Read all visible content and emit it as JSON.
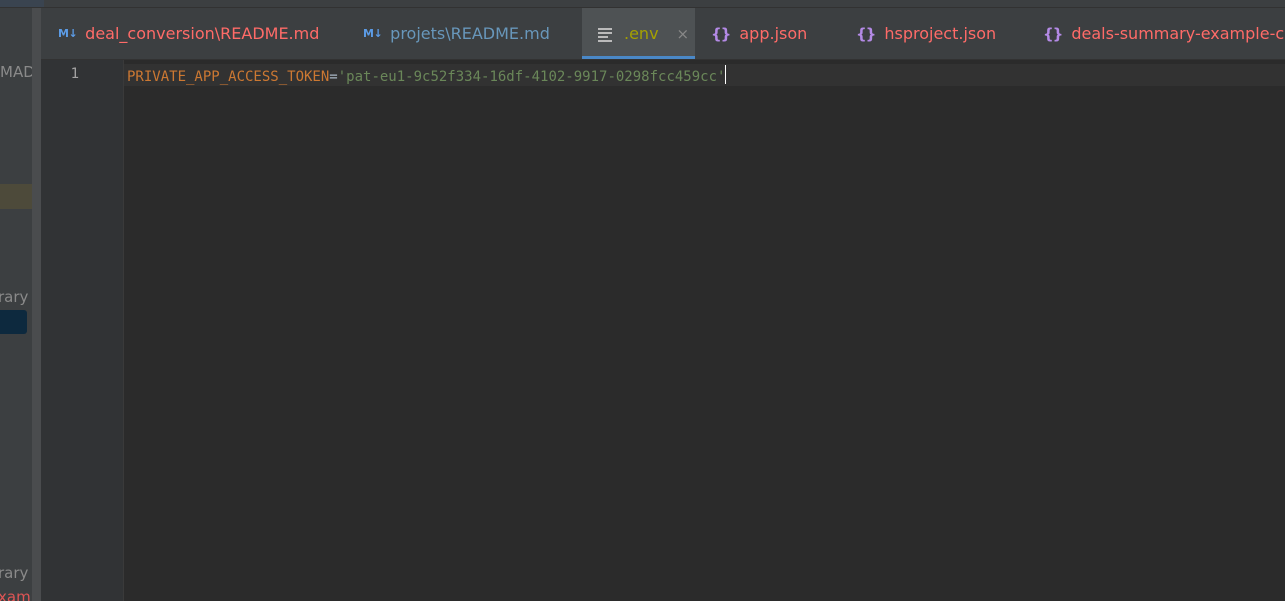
{
  "tabs": [
    {
      "icon": "markdown-icon",
      "badge": "M↓",
      "label": "deal_conversion\\README.md",
      "color": "#ff6b68"
    },
    {
      "icon": "markdown-icon",
      "badge": "M↓",
      "label": "projets\\README.md",
      "color": "#6897bb"
    },
    {
      "icon": "text-file-icon",
      "label": ".env",
      "color": "#a4a000",
      "close": "×"
    },
    {
      "icon": "json-icon",
      "badge": "{}",
      "label": "app.json",
      "color": "#ff6b68"
    },
    {
      "icon": "json-icon",
      "badge": "{}",
      "label": "hsproject.json",
      "color": "#ff6b68"
    },
    {
      "icon": "json-icon",
      "badge": "{}",
      "label": "deals-summary-example-card",
      "color": "#ff6b68"
    }
  ],
  "left_panel": {
    "items": [
      {
        "text": "MADA",
        "color": "#8a8a8a"
      },
      {
        "text": "rary r",
        "color": "#8a8a8a"
      },
      {
        "text": "rary r",
        "color": "#8a8a8a"
      },
      {
        "text": "xampl",
        "color": "#e05555"
      }
    ]
  },
  "editor": {
    "line_number": "1",
    "key": "PRIVATE_APP_ACCESS_TOKEN",
    "eq": "=",
    "value": "'pat-eu1-9c52f334-16df-4102-9917-0298fcc459cc'"
  },
  "colors": {
    "accent": "#4a88c7",
    "key": "#cc7832",
    "string": "#6a8759",
    "modified_tab": "#ff6b68"
  }
}
